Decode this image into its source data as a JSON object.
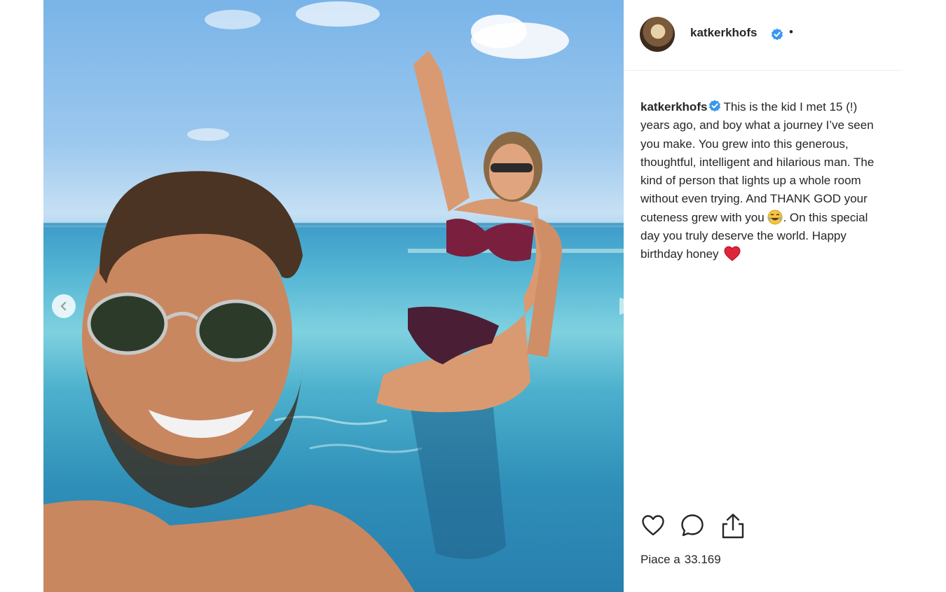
{
  "post": {
    "username": "katkerkhofs",
    "header_separator": "•",
    "caption_user": "katkerkhofs",
    "caption_part1": "This is the kid I met 15 (!) years ago, and boy what a journey I’ve seen you make. You grew into this generous, thoughtful, intelligent and hilarious man. The kind of person that lights up a whole room without even trying. And THANK GOD your cuteness grew with you",
    "caption_part2": ". On this special day you truly deserve the world. Happy birthday honey",
    "likes_label": "Piace a",
    "likes_count": "33.169"
  },
  "icons": {
    "verified": "verified-badge-icon",
    "emoji_1": "tears-of-joy-emoji",
    "emoji_2": "red-heart-emoji",
    "like": "heart-outline-icon",
    "comment": "comment-bubble-icon",
    "share": "share-upload-icon",
    "carousel_prev": "chevron-left-icon"
  },
  "colors": {
    "verified_blue": "#3897f0",
    "heart_red": "#e0243a",
    "text": "#262626"
  }
}
